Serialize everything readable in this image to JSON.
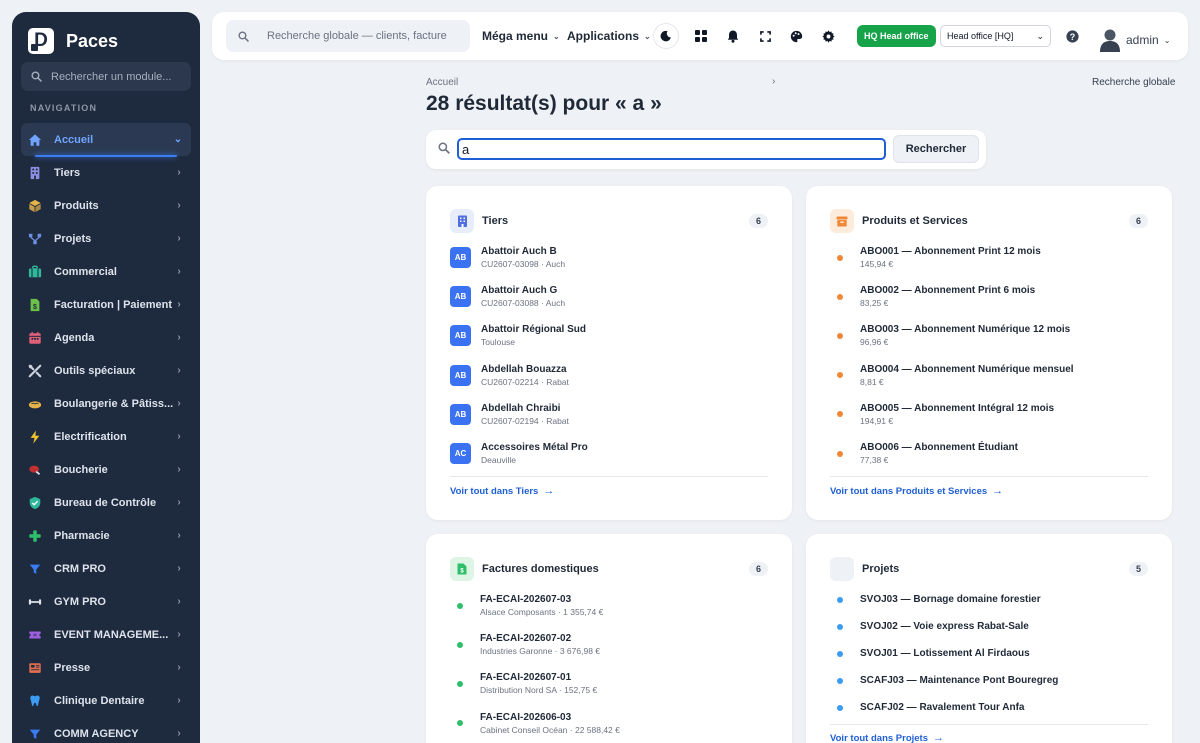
{
  "brand": {
    "name": "Paces",
    "logo_letter": "D"
  },
  "sidebar": {
    "search_placeholder": "Rechercher un module...",
    "nav_title": "NAVIGATION",
    "items": [
      {
        "label": "Accueil",
        "icon": "home-icon",
        "color": "#6fa4ff",
        "active": true
      },
      {
        "label": "Tiers",
        "icon": "building-icon",
        "color": "#8b8fe0"
      },
      {
        "label": "Produits",
        "icon": "box-icon",
        "color": "#e6b34a"
      },
      {
        "label": "Projets",
        "icon": "network-icon",
        "color": "#6b8fe0"
      },
      {
        "label": "Commercial",
        "icon": "briefcase-icon",
        "color": "#2fb89a"
      },
      {
        "label": "Facturation | Paiement",
        "icon": "invoice-icon",
        "color": "#6cc04a"
      },
      {
        "label": "Agenda",
        "icon": "calendar-icon",
        "color": "#e0607a"
      },
      {
        "label": "Outils spéciaux",
        "icon": "tools-icon",
        "color": "#c9d1dc"
      },
      {
        "label": "Boulangerie & Pâtiss...",
        "icon": "bread-icon",
        "color": "#e6b34a"
      },
      {
        "label": "Electrification",
        "icon": "bolt-icon",
        "color": "#f2c230"
      },
      {
        "label": "Boucherie",
        "icon": "meat-icon",
        "color": "#c03030"
      },
      {
        "label": "Bureau de Contrôle",
        "icon": "shield-icon",
        "color": "#2fb89a"
      },
      {
        "label": "Pharmacie",
        "icon": "plus-icon",
        "color": "#2fbf6a"
      },
      {
        "label": "CRM PRO",
        "icon": "funnel-icon",
        "color": "#3b7cf2"
      },
      {
        "label": "GYM PRO",
        "icon": "dumbbell-icon",
        "color": "#dde3ec"
      },
      {
        "label": "EVENT MANAGEME...",
        "icon": "ticket-icon",
        "color": "#a060e0"
      },
      {
        "label": "Presse",
        "icon": "newspaper-icon",
        "color": "#e07050"
      },
      {
        "label": "Clinique Dentaire",
        "icon": "tooth-icon",
        "color": "#3b9cf2"
      },
      {
        "label": "COMM AGENCY",
        "icon": "funnel-icon",
        "color": "#3b7cf2"
      }
    ]
  },
  "topbar": {
    "search_placeholder": "Recherche globale — clients, factures, p",
    "mega_menu": "Méga menu",
    "applications": "Applications",
    "hq_badge": "HQ Head office",
    "hq_select": "Head office [HQ]",
    "user": "admin"
  },
  "main": {
    "breadcrumb": "Accueil",
    "breadcrumb_sep": "›",
    "breadcrumb_right": "Recherche globale",
    "title": "28 résultat(s) pour « a »",
    "search_value": "a",
    "search_button": "Rechercher"
  },
  "cards": {
    "tiers": {
      "title": "Tiers",
      "count": "6",
      "see_all": "Voir tout dans Tiers",
      "items": [
        {
          "initials": "AB",
          "title": "Abattoir Auch B",
          "sub": "CU2607-03098 · Auch"
        },
        {
          "initials": "AB",
          "title": "Abattoir Auch G",
          "sub": "CU2607-03088 · Auch"
        },
        {
          "initials": "AB",
          "title": "Abattoir Régional Sud",
          "sub": "Toulouse"
        },
        {
          "initials": "AB",
          "title": "Abdellah Bouazza",
          "sub": "CU2607-02214 · Rabat"
        },
        {
          "initials": "AB",
          "title": "Abdellah Chraibi",
          "sub": "CU2607-02194 · Rabat"
        },
        {
          "initials": "AC",
          "title": "Accessoires Métal Pro",
          "sub": "Deauville"
        }
      ]
    },
    "products": {
      "title": "Produits et Services",
      "count": "6",
      "see_all": "Voir tout dans Produits et Services",
      "dot_color": "#f0883a",
      "items": [
        {
          "title": "ABO001 — Abonnement Print 12 mois",
          "sub": "145,94 €"
        },
        {
          "title": "ABO002 — Abonnement Print 6 mois",
          "sub": "83,25 €"
        },
        {
          "title": "ABO003 — Abonnement Numérique 12 mois",
          "sub": "96,96 €"
        },
        {
          "title": "ABO004 — Abonnement Numérique mensuel",
          "sub": "8,81 €"
        },
        {
          "title": "ABO005 — Abonnement Intégral 12 mois",
          "sub": "194,91 €"
        },
        {
          "title": "ABO006 — Abonnement Étudiant",
          "sub": "77,38 €"
        }
      ]
    },
    "invoices": {
      "title": "Factures domestiques",
      "count": "6",
      "dot_color": "#2fbf6a",
      "items": [
        {
          "title": "FA-ECAI-202607-03",
          "sub": "Alsace Composants · 1 355,74 €"
        },
        {
          "title": "FA-ECAI-202607-02",
          "sub": "Industries Garonne · 3 676,98 €"
        },
        {
          "title": "FA-ECAI-202607-01",
          "sub": "Distribution Nord SA · 152,75 €"
        },
        {
          "title": "FA-ECAI-202606-03",
          "sub": "Cabinet Conseil Océan · 22 588,42 €"
        }
      ]
    },
    "projects": {
      "title": "Projets",
      "count": "5",
      "see_all": "Voir tout dans Projets",
      "dot_color": "#3b9cf2",
      "items": [
        {
          "title": "SVOJ03 — Bornage domaine forestier"
        },
        {
          "title": "SVOJ02 — Voie express Rabat-Sale"
        },
        {
          "title": "SVOJ01 — Lotissement Al Firdaous"
        },
        {
          "title": "SCAFJ03 — Maintenance Pont Bouregreg"
        },
        {
          "title": "SCAFJ02 — Ravalement Tour Anfa"
        }
      ]
    }
  }
}
